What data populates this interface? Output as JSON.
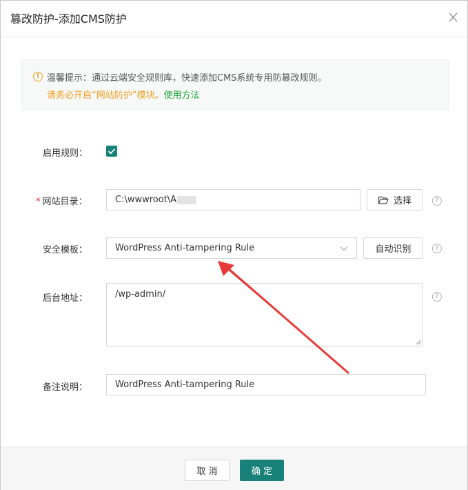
{
  "dialog": {
    "title": "篡改防护-添加CMS防护"
  },
  "notice": {
    "line1": "温馨提示：通过云端安全规则库，快速添加CMS系统专用防篡改规则。",
    "line2_prefix": "请务必开启“网站防护”模块。",
    "line2_link": "使用方法"
  },
  "form": {
    "enable_label": "启用规则：",
    "enabled": true,
    "dir_required_mark": "*",
    "dir_label": "网站目录：",
    "dir_value": "C:\\wwwroot\\A",
    "choose_button": "选择",
    "template_label": "安全模板：",
    "template_value": "WordPress Anti-tampering Rule",
    "auto_detect_button": "自动识别",
    "admin_label": "后台地址：",
    "admin_value": "/wp-admin/",
    "note_label": "备注说明：",
    "note_value": "WordPress Anti-tampering Rule"
  },
  "footer": {
    "cancel_button": "取 消",
    "confirm_button": "确 定"
  },
  "colors": {
    "primary": "#17817a",
    "warning": "#f0a020",
    "link": "#20a53a",
    "annotation_arrow": "#e83a3a"
  },
  "icons": {
    "close": "close-icon",
    "warning": "warning-icon",
    "folder": "folder-icon",
    "help": "help-icon",
    "chevron": "chevron-down-icon",
    "check": "check-icon"
  }
}
